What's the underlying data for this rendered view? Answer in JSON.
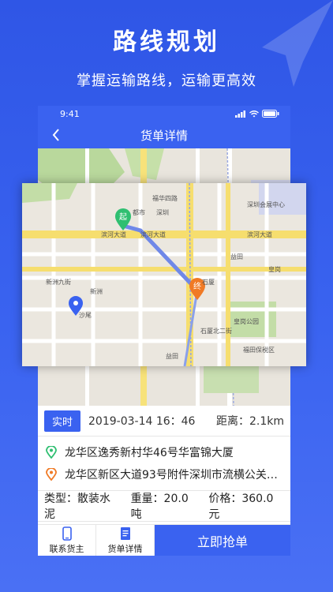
{
  "promo": {
    "title": "路线规划",
    "subtitle": "掌握运输路线，运输更高效"
  },
  "status_bar": {
    "time": "9:41"
  },
  "navbar": {
    "title": "货单详情"
  },
  "map": {
    "labels": {
      "start_marker": "起",
      "end_marker": "终",
      "binhe_road": "滨河大道",
      "binhe_road_2": "滨河大道",
      "binhe_road_3": "滨河大道",
      "xinzhou_rd": "新洲九街",
      "xinzhou": "新洲",
      "huanggang": "皇岗",
      "shixia": "石厦",
      "shixia_bei": "石厦北二街",
      "futian_bonded": "福田保税区",
      "shenzhen_center": "深圳会展中心",
      "huanggang_park": "皇岗公园",
      "fuhua_rd": "福华四路",
      "yinhu": "益田",
      "shenzhen_stadium": "深圳",
      "yitian": "益田",
      "shaheyu": "沙尾",
      "zhongxin": "都市"
    }
  },
  "order": {
    "tag": "实时",
    "datetime": "2019-03-14  16：46",
    "distance": "距离：2.1km",
    "from_address": "龙华区逸秀新村华46号华富锦大厦",
    "to_address": "龙华区新区大道93号附件深圳市流横公关…",
    "cargo_type": "类型：散装水泥",
    "weight": "重量：20.0吨",
    "price": "价格：360.0元"
  },
  "bottom_bar": {
    "contact_label": "联系货主",
    "detail_label": "货单详情",
    "grab_label": "立即抢单"
  },
  "colors": {
    "brand_blue": "#3a62f0",
    "start_green": "#2fbf71",
    "end_orange": "#f07a25",
    "route_blue": "#6f88e8"
  }
}
